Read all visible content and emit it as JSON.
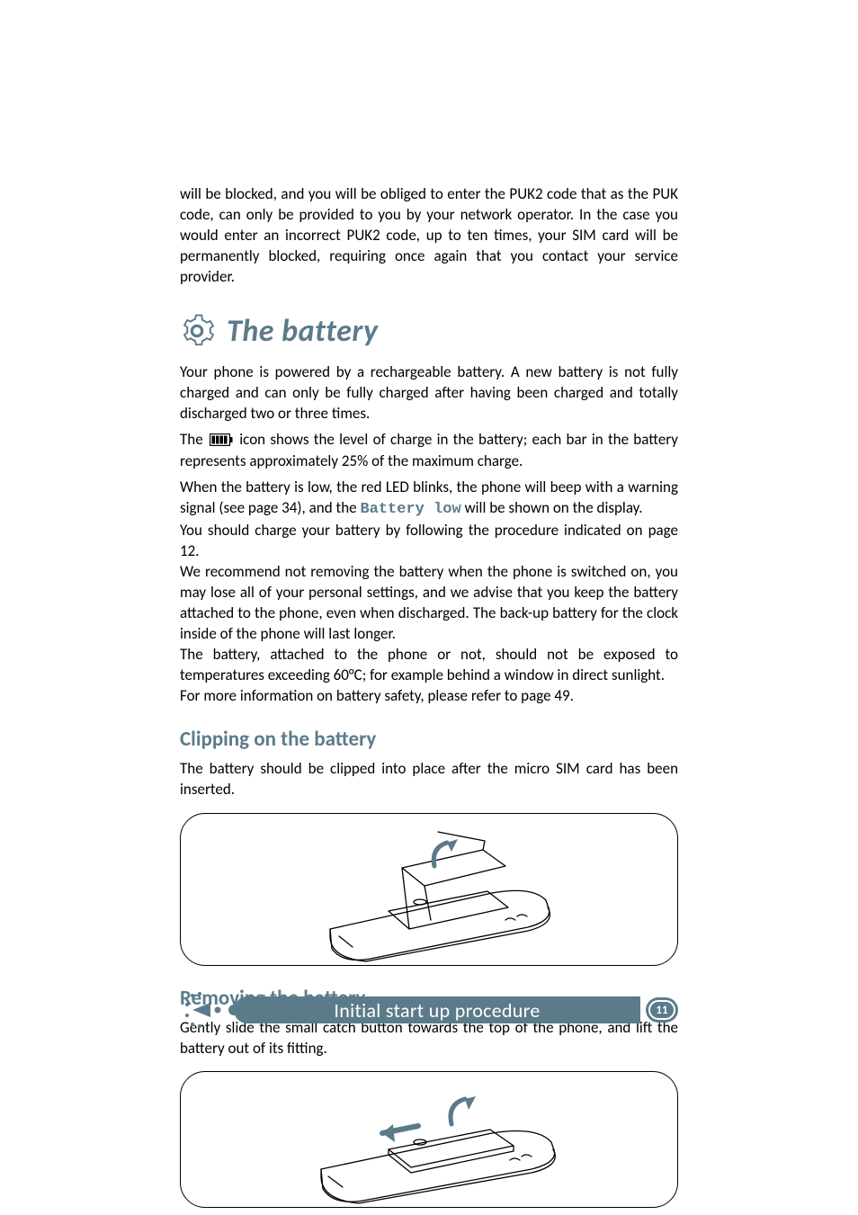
{
  "intro_paragraph": "will be blocked, and you will be obliged to enter the PUK2 code that as the PUK code, can only be provided to you by your network operator.  In the case you would enter an incorrect PUK2 code, up to ten times, your SIM card will be permanently blocked, requiring once again that you contact your service provider.",
  "section": {
    "title": "The battery",
    "p1": "Your phone is powered by a rechargeable battery.  A new battery is not fully charged and can only be fully charged after having been charged and totally discharged two or three times.",
    "p2_pre": "The ",
    "p2_post": " icon shows the level of charge in the battery; each bar in the battery represents approximately 25% of the maximum charge.",
    "p3_line1": "When the battery is low, the red LED blinks, the phone will beep with a warning signal (see page 34), and the ",
    "p3_code": "Battery low",
    "p3_line1_end": " will be shown on the display.",
    "p3_line2": "You should charge your battery by following the procedure indicated on page 12.",
    "p3_line3": "We recommend not removing the battery when the phone is switched on, you may lose all of your personal settings, and we advise that you keep the battery attached to the phone, even when discharged.  The back-up battery for the clock inside of the phone will last longer.",
    "p3_line4": "The battery, attached to the phone or not, should not be exposed to temperatures exceeding 60°C; for example behind a window in direct sunlight.",
    "p3_line5": "For more information on battery safety, please refer to page 49."
  },
  "clipping": {
    "title": "Clipping on the battery",
    "text": "The battery should be clipped into place after the micro SIM card has been inserted."
  },
  "removing": {
    "title": "Removing the battery",
    "text": "Gently slide the small catch button towards the top of the phone, and lift the battery out of its fitting."
  },
  "footer": {
    "label": "Initial start up procedure",
    "page_number": "11"
  },
  "icons": {
    "gear": "gear-icon",
    "battery": "battery-level-icon"
  }
}
